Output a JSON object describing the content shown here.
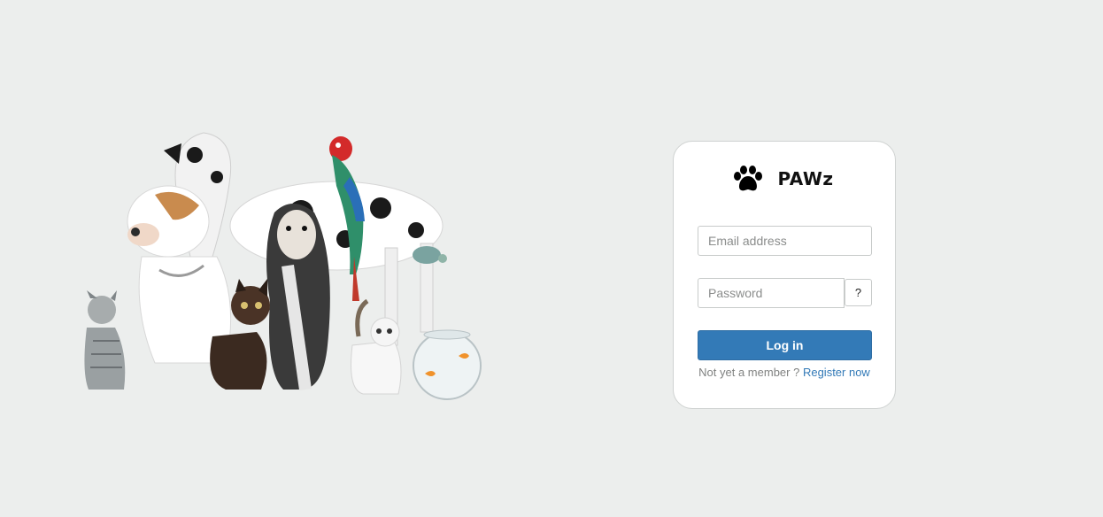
{
  "brand": {
    "name": "PAWz",
    "icon": "paw-icon"
  },
  "login_form": {
    "email_placeholder": "Email address",
    "email_value": "",
    "password_placeholder": "Password",
    "password_value": "",
    "help_label": "?",
    "submit_label": "Log in",
    "register_prompt": "Not yet a member ?",
    "register_link": "Register now"
  },
  "hero": {
    "image": "pets-group-illustration"
  },
  "colors": {
    "background": "#eceeed",
    "card": "#ffffff",
    "primary": "#337ab7",
    "link": "#337ab7",
    "muted_text": "#808281"
  }
}
